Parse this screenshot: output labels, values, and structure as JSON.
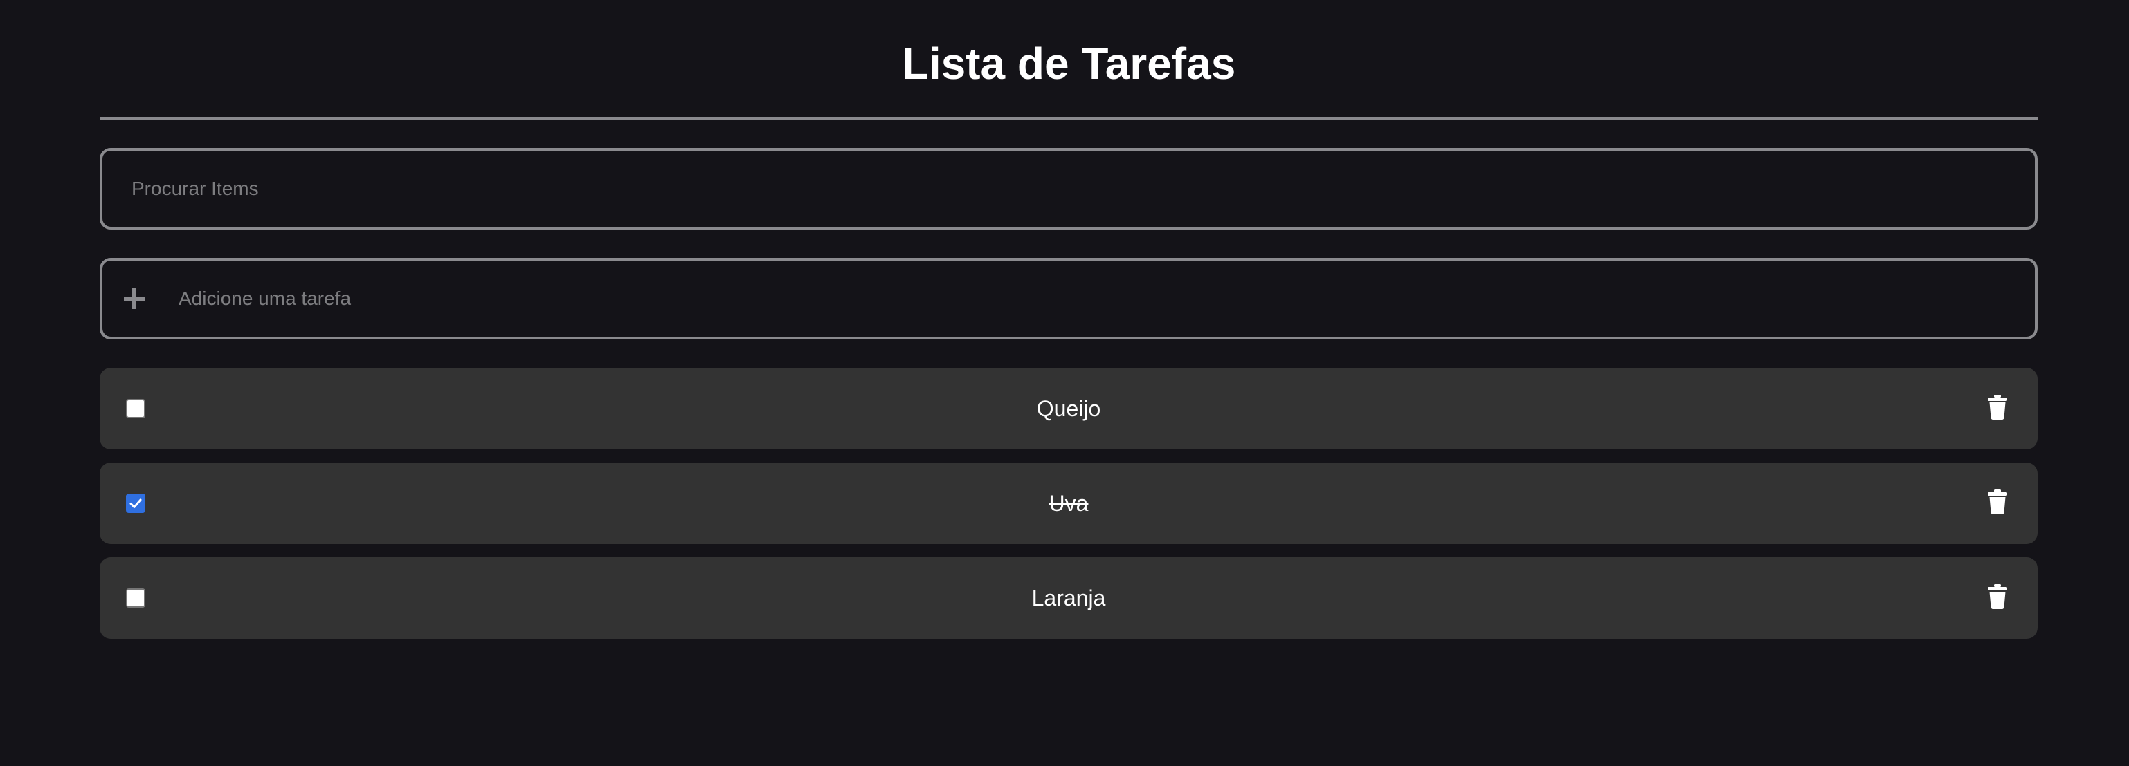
{
  "header": {
    "title": "Lista de Tarefas"
  },
  "search": {
    "placeholder": "Procurar Items",
    "value": ""
  },
  "add_task": {
    "placeholder": "Adicione uma tarefa",
    "value": "",
    "icon": "plus-icon"
  },
  "tasks": [
    {
      "label": "Queijo",
      "done": false,
      "delete_icon": "trash-icon"
    },
    {
      "label": "Uva",
      "done": true,
      "delete_icon": "trash-icon"
    },
    {
      "label": "Laranja",
      "done": false,
      "delete_icon": "trash-icon"
    }
  ],
  "colors": {
    "background": "#141318",
    "item_background": "#333333",
    "border": "#8a8a8e",
    "checkbox_checked": "#2f6fe0",
    "text": "#ffffff",
    "placeholder": "#7d7d80"
  }
}
